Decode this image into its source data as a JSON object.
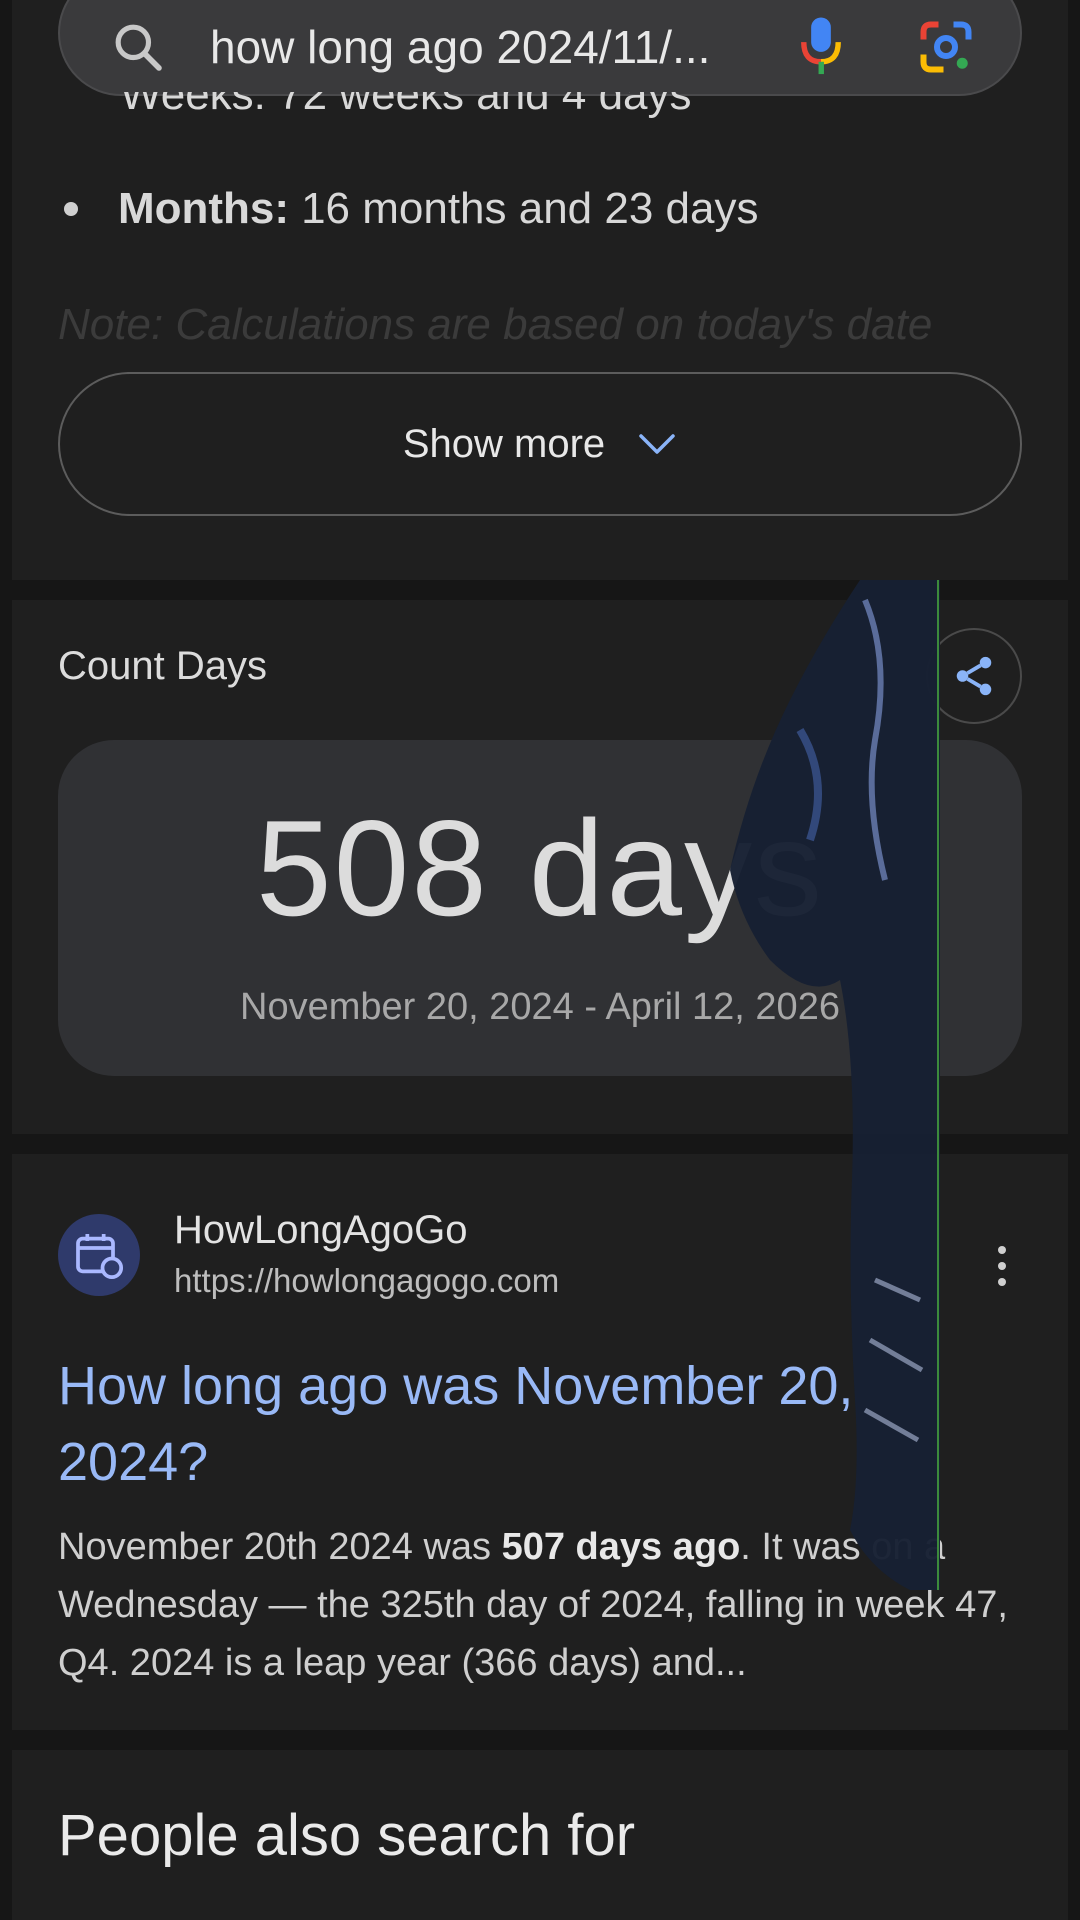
{
  "search": {
    "query": "how long ago 2024/11/..."
  },
  "result_summary": {
    "cut_line": "Weeks: 72 weeks and 4 days",
    "bullet_label": "Months:",
    "bullet_value": "16 months and 23 days",
    "note": "Note: Calculations are based on today's date",
    "show_more_label": "Show more"
  },
  "count_days": {
    "title": "Count Days",
    "value": "508 days",
    "range": "November 20, 2024 - April 12, 2026"
  },
  "web_result": {
    "site_name": "HowLongAgoGo",
    "url": "https://howlongagogo.com",
    "title": "How long ago was November 20, 2024?",
    "snippet_pre": "November 20th 2024 was ",
    "snippet_bold": "507 days ago",
    "snippet_post": ". It was on a Wednesday — the 325th day of 2024, falling in week 47, Q4. 2024 is a leap year (366 days) and..."
  },
  "people_also_search": {
    "heading": "People also search for"
  },
  "colors": {
    "background": "#1f1f1f",
    "link": "#99b9f6",
    "card": "#303134"
  }
}
